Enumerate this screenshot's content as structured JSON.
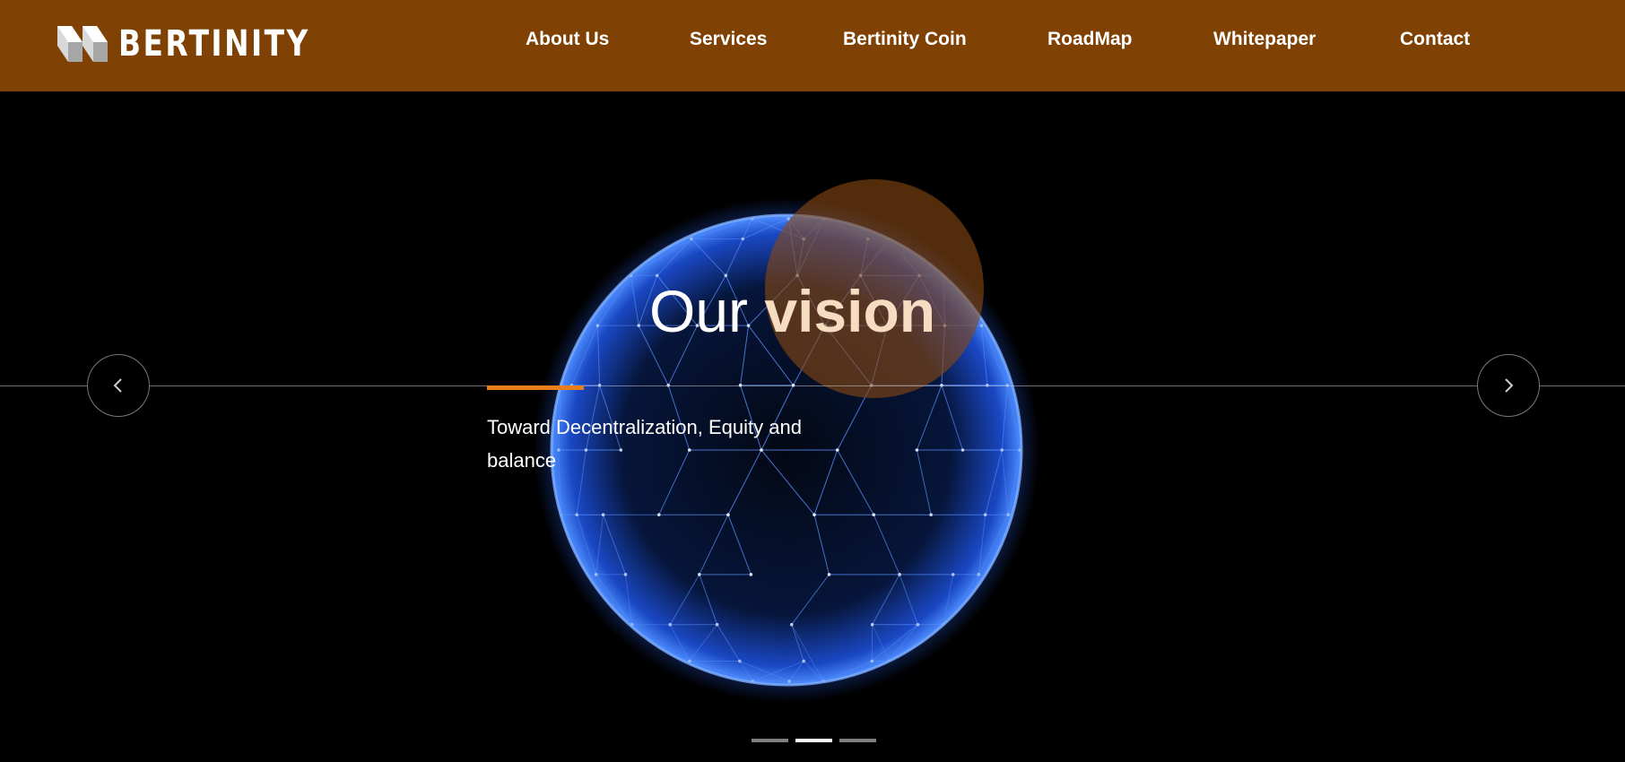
{
  "header": {
    "logo_text": "BERTINITY",
    "nav": [
      {
        "label": "About Us"
      },
      {
        "label": "Services"
      },
      {
        "label": "Bertinity Coin"
      },
      {
        "label": "RoadMap"
      },
      {
        "label": "Whitepaper"
      },
      {
        "label": "Contact"
      }
    ]
  },
  "hero": {
    "title_part1": "Our",
    "title_part2": "vision",
    "subtitle": "Toward Decentralization, Equity and balance",
    "prev_icon": "chevron-left-icon",
    "next_icon": "chevron-right-icon",
    "slides": {
      "count": 3,
      "active_index": 1
    }
  },
  "colors": {
    "header_bg": "#7f4204",
    "accent": "#e87f1a",
    "title_highlight": "#f6dcc0",
    "globe": "#3d7bff"
  }
}
